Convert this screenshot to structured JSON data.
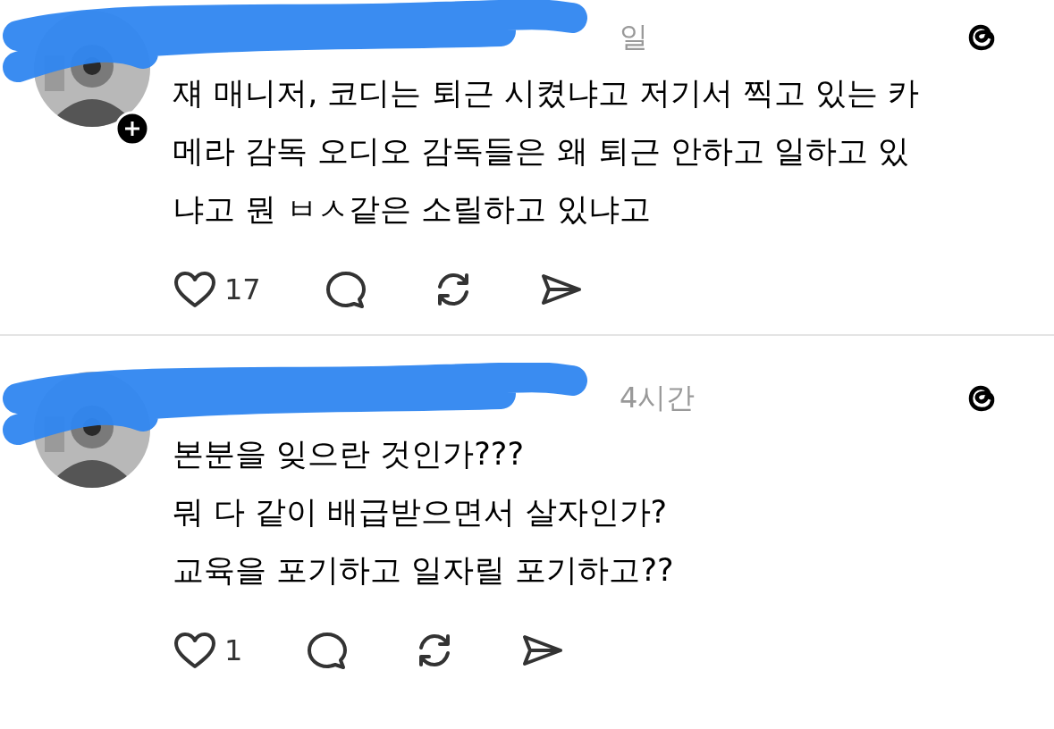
{
  "posts": [
    {
      "time": "일",
      "has_follow_badge": true,
      "lines": [
        "쟤 매니저, 코디는 퇴근 시켰냐고 저기서 찍고 있는 카",
        "메라 감독 오디오 감독들은 왜 퇴근 안하고 일하고 있",
        "냐고 뭔 ㅂㅅ같은 소릴하고 있냐고"
      ],
      "likes": "17"
    },
    {
      "time": "4시간",
      "has_follow_badge": false,
      "lines": [
        "본분을 잊으란 것인가???",
        "뭐 다 같이 배급받으면서 살자인가?",
        "교육을 포기하고 일자릴 포기하고??"
      ],
      "likes": "1"
    }
  ]
}
